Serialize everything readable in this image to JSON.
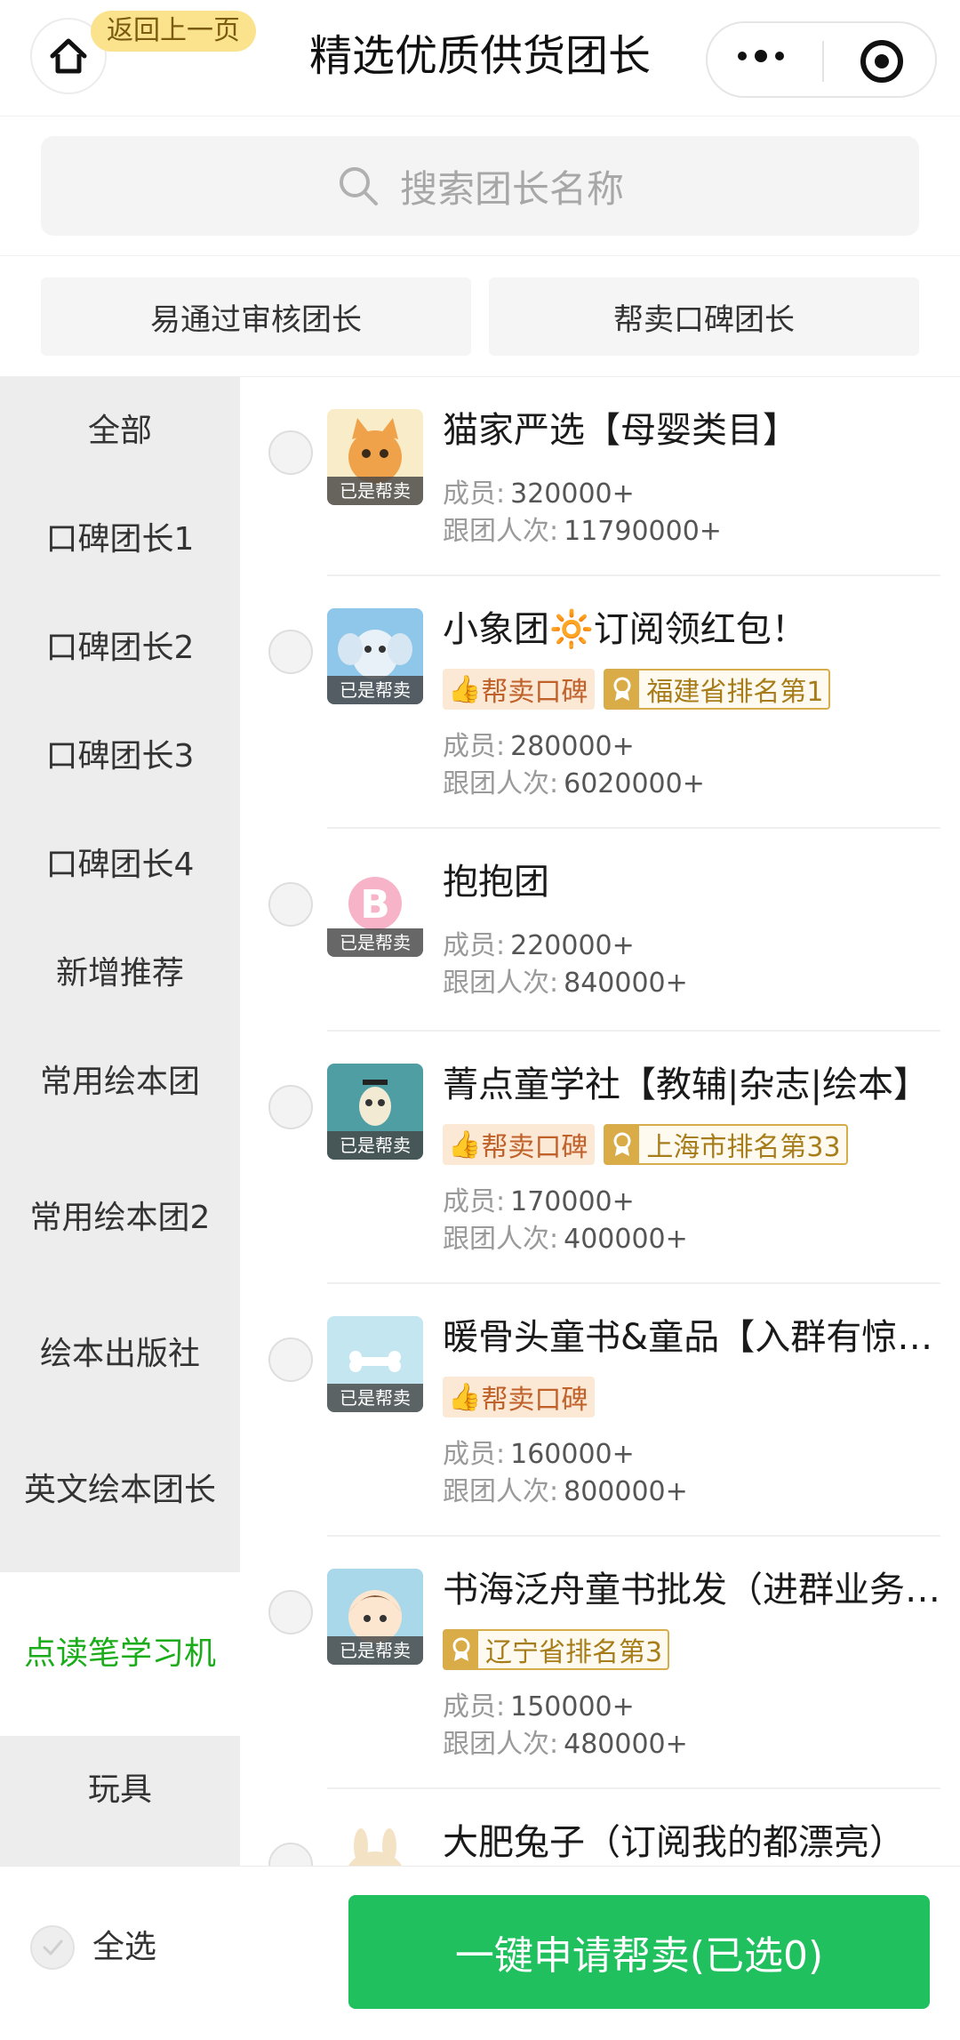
{
  "header": {
    "back_label": "返回上一页",
    "title": "精选优质供货团长",
    "home_icon": "home-icon",
    "more_icon": "more-icon",
    "close_icon": "target-icon"
  },
  "search": {
    "placeholder": "搜索团长名称",
    "icon": "search-icon"
  },
  "filters": [
    {
      "label": "易通过审核团长"
    },
    {
      "label": "帮卖口碑团长"
    }
  ],
  "sidebar": {
    "items": [
      {
        "label": "全部"
      },
      {
        "label": "口碑团长1"
      },
      {
        "label": "口碑团长2"
      },
      {
        "label": "口碑团长3"
      },
      {
        "label": "口碑团长4"
      },
      {
        "label": "新增推荐"
      },
      {
        "label": "常用绘本团"
      },
      {
        "label": "常用绘本团2"
      },
      {
        "label": "绘本出版社"
      },
      {
        "label": "英文绘本团长"
      },
      {
        "label": "点读笔学习机",
        "active": true
      },
      {
        "label": "玩具"
      }
    ]
  },
  "labels": {
    "members": "成员:",
    "visits": "跟团人次:",
    "helping_tag": "已是帮卖"
  },
  "leaders": [
    {
      "name": "猫家严选【母婴类目】",
      "badges": [],
      "members": "320000+",
      "visits": "11790000+",
      "avatar_color": "#f6e2a8"
    },
    {
      "name": "小象团🔆订阅领红包！",
      "badges": [
        {
          "type": "praise",
          "text": "帮卖口碑"
        },
        {
          "type": "rank",
          "text": "福建省排名第1"
        }
      ],
      "members": "280000+",
      "visits": "6020000+",
      "avatar_color": "#9fd0ef"
    },
    {
      "name": "抱抱团",
      "badges": [],
      "members": "220000+",
      "visits": "840000+",
      "avatar_color": "#f4c6d4"
    },
    {
      "name": "菁点童学社【教辅|杂志|绘本】",
      "badges": [
        {
          "type": "praise",
          "text": "帮卖口碑"
        },
        {
          "type": "rank",
          "text": "上海市排名第33"
        }
      ],
      "members": "170000+",
      "visits": "400000+",
      "avatar_color": "#5fa3a6"
    },
    {
      "name": "暖骨头童书&童品【入群有惊喜】",
      "badges": [
        {
          "type": "praise",
          "text": "帮卖口碑"
        }
      ],
      "members": "160000+",
      "visits": "800000+",
      "avatar_color": "#bfe3ef"
    },
    {
      "name": "书海泛舟童书批发（进群业务咨询）",
      "badges": [
        {
          "type": "rank",
          "text": "辽宁省排名第3"
        }
      ],
      "members": "150000+",
      "visits": "480000+",
      "avatar_color": "#a9d9ea"
    },
    {
      "name": "大肥兔子（订阅我的都漂亮）",
      "badges": [],
      "members": "",
      "visits": "",
      "avatar_color": "#f3e2c4"
    }
  ],
  "bottom": {
    "select_all": "全选",
    "apply": "一键申请帮卖(已选0)"
  },
  "colors": {
    "accent": "#20c05f",
    "active_side": "#1aad19",
    "pill": "#fbe28c"
  }
}
